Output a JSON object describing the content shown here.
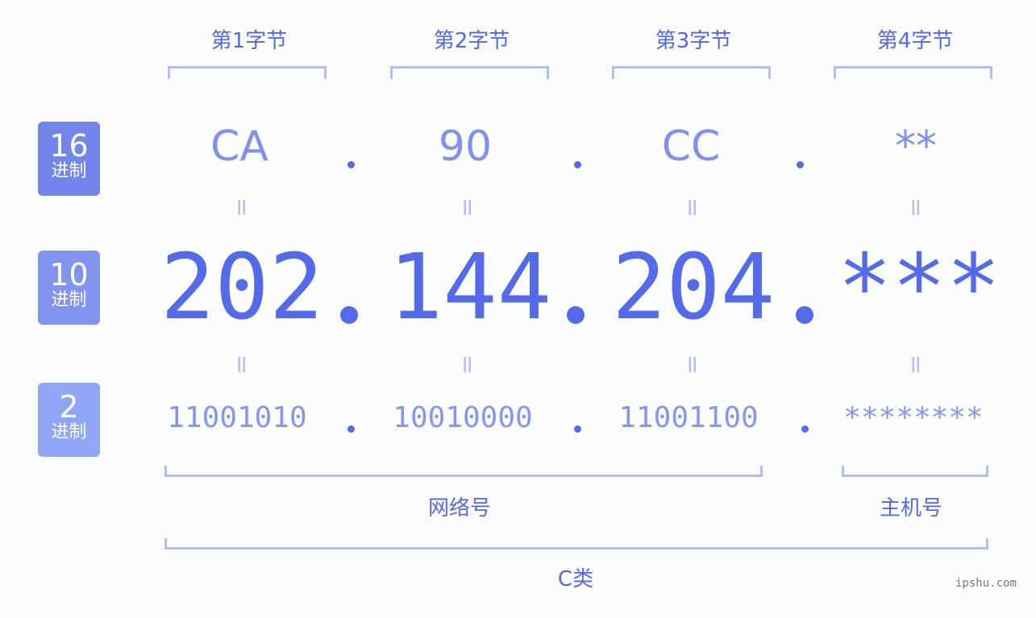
{
  "headers": [
    "第1字节",
    "第2字节",
    "第3字节",
    "第4字节"
  ],
  "badges": [
    {
      "num": "16",
      "unit": "进制",
      "color": "#7384ea"
    },
    {
      "num": "10",
      "unit": "进制",
      "color": "#8294f0"
    },
    {
      "num": "2",
      "unit": "进制",
      "color": "#8fa6f7"
    }
  ],
  "hex": [
    "CA",
    "90",
    "CC",
    "**"
  ],
  "decimal": [
    "202",
    "144",
    "204",
    "***"
  ],
  "binary": [
    "11001010",
    "10010000",
    "11001100",
    "********"
  ],
  "equals_sign": "=",
  "labels": {
    "network": "网络号",
    "host": "主机号",
    "class": "C类"
  },
  "watermark": "ipshu.com",
  "colors": {
    "accent": "#546ae8",
    "bracket": "#b3bdf7",
    "hex_text": "#8090ef",
    "bin_text": "#8696f0"
  }
}
